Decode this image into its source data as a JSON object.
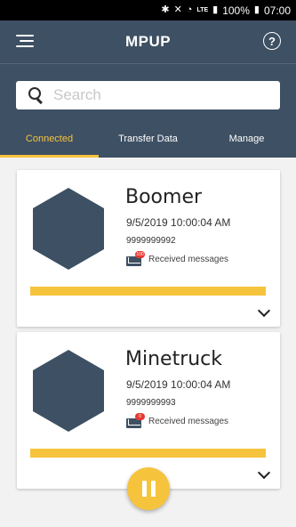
{
  "status_bar": {
    "battery": "100%",
    "time": "07:00",
    "network": "LTE"
  },
  "app_bar": {
    "title": "MPUP",
    "help_label": "?"
  },
  "search": {
    "placeholder": "Search"
  },
  "tabs": [
    {
      "label": "Connected",
      "active": true
    },
    {
      "label": "Transfer Data",
      "active": false
    },
    {
      "label": "Manage",
      "active": false
    }
  ],
  "devices": [
    {
      "name": "Boomer",
      "time": "9/5/2019 10:00:04 AM",
      "phone": "9999999992",
      "badge": "100",
      "messages_label": "Received messages",
      "progress": 1.0
    },
    {
      "name": "Minetruck",
      "time": "9/5/2019 10:00:04 AM",
      "phone": "9999999993",
      "badge": "0",
      "messages_label": "Received messages",
      "progress": 1.0
    }
  ],
  "colors": {
    "primary": "#3e5063",
    "accent": "#f6c33c",
    "badge": "#e53935"
  },
  "icons": {
    "menu": "menu-icon",
    "help": "help-icon",
    "search": "search-icon",
    "mail": "mail-icon",
    "pause": "pause-icon",
    "chevron": "chevron-down-icon"
  }
}
